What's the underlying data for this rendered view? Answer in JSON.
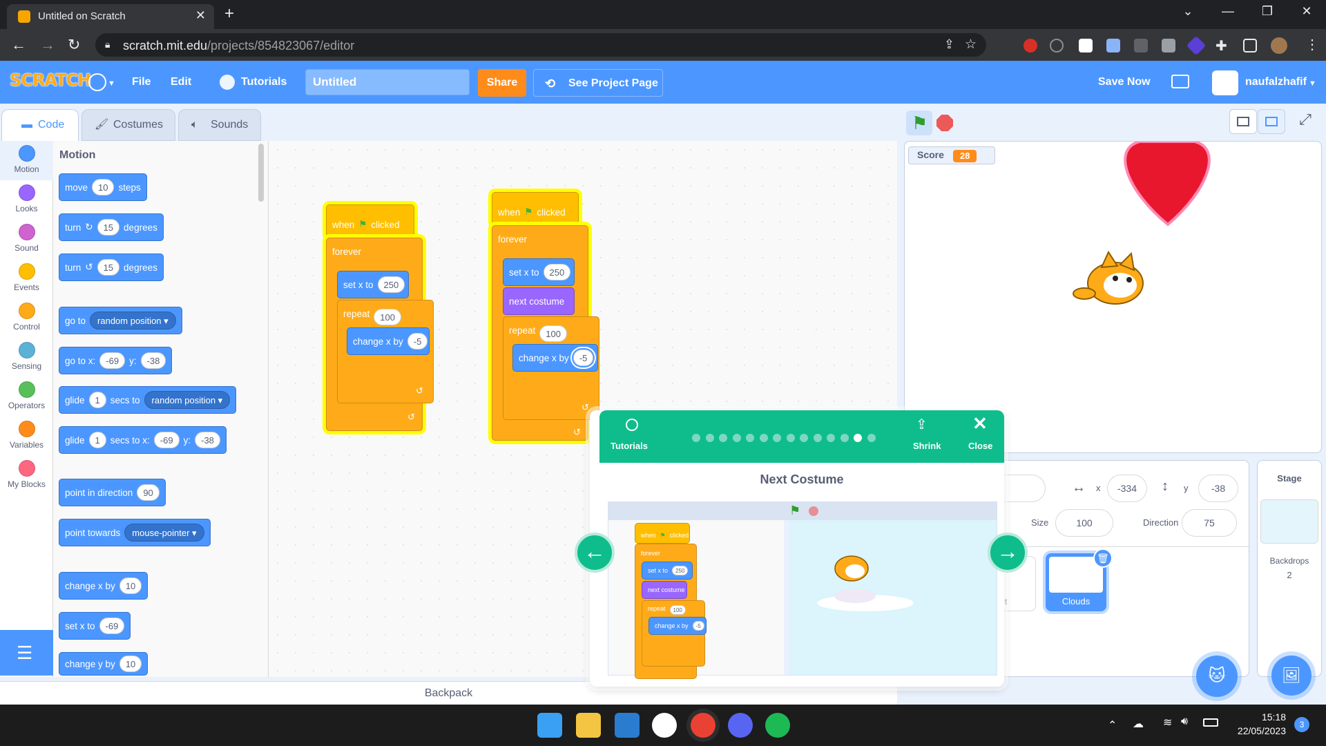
{
  "browser": {
    "tab_title": "Untitled on Scratch",
    "tab_close": "✕",
    "new_tab": "+",
    "url_host": "scratch.mit.edu",
    "url_path": "/projects/854823067/editor",
    "window_controls": [
      "⌄",
      "—",
      "❐",
      "✕"
    ]
  },
  "menubar": {
    "logo": "SCRATCH",
    "file": "File",
    "edit": "Edit",
    "tutorials": "Tutorials",
    "project_title": "Untitled",
    "share": "Share",
    "see_project": "See Project Page",
    "save_now": "Save Now",
    "username": "naufalzhafif",
    "colors": {
      "bar": "#4c97ff",
      "share": "#ff8c1a"
    }
  },
  "editor_tabs": [
    "Code",
    "Costumes",
    "Sounds"
  ],
  "categories": [
    {
      "label": "Motion",
      "color": "#4c97ff"
    },
    {
      "label": "Looks",
      "color": "#9966ff"
    },
    {
      "label": "Sound",
      "color": "#cf63cf"
    },
    {
      "label": "Events",
      "color": "#ffbf00"
    },
    {
      "label": "Control",
      "color": "#ffab19"
    },
    {
      "label": "Sensing",
      "color": "#5cb1d6"
    },
    {
      "label": "Operators",
      "color": "#59c059"
    },
    {
      "label": "Variables",
      "color": "#ff8c1a"
    },
    {
      "label": "My Blocks",
      "color": "#ff6680"
    }
  ],
  "palette": {
    "title": "Motion",
    "move": {
      "a": "move",
      "v": "10",
      "b": "steps"
    },
    "turn_cw": {
      "a": "turn",
      "v": "15",
      "b": "degrees"
    },
    "turn_ccw": {
      "a": "turn",
      "v": "15",
      "b": "degrees"
    },
    "goto": {
      "a": "go to",
      "dd": "random position"
    },
    "gotoxy": {
      "a": "go to x:",
      "x": "-69",
      "b": "y:",
      "y": "-38"
    },
    "glide": {
      "a": "glide",
      "v": "1",
      "b": "secs to",
      "dd": "random position"
    },
    "glidexy": {
      "a": "glide",
      "v": "1",
      "b": "secs to x:",
      "x": "-69",
      "c": "y:",
      "y": "-38"
    },
    "point_dir": {
      "a": "point in direction",
      "v": "90"
    },
    "point_towards": {
      "a": "point towards",
      "dd": "mouse-pointer"
    },
    "change_x": {
      "a": "change x by",
      "v": "10"
    },
    "set_x": {
      "a": "set x to",
      "v": "-69"
    },
    "change_y": {
      "a": "change y by",
      "v": "10"
    }
  },
  "scripts": {
    "s1": {
      "when": "when",
      "clicked": "clicked",
      "forever": "forever",
      "setx": "set x to",
      "setx_v": "250",
      "repeat": "repeat",
      "repeat_v": "100",
      "changex": "change x by",
      "changex_v": "-5"
    },
    "s2": {
      "when": "when",
      "clicked": "clicked",
      "forever": "forever",
      "setx": "set x to",
      "setx_v": "250",
      "next": "next costume",
      "repeat": "repeat",
      "repeat_v": "100",
      "changex": "change x by",
      "changex_v": "-5"
    }
  },
  "backpack": "Backpack",
  "stage": {
    "score_label": "Score",
    "score_value": "28"
  },
  "sprite_info": {
    "x_label": "x",
    "x": "-334",
    "y_label": "y",
    "y": "-38",
    "size_label": "Size",
    "size": "100",
    "direction_label": "Direction",
    "direction": "75",
    "sprite_partial_label": "rt",
    "selected_sprite": "Clouds"
  },
  "stage_panel": {
    "title": "Stage",
    "backdrops_label": "Backdrops",
    "backdrops_count": "2"
  },
  "tutorial": {
    "tutorials_label": "Tutorials",
    "shrink": "Shrink",
    "close": "Close",
    "title": "Next Costume",
    "dots_total": 14,
    "dots_active_index": 12,
    "mini": {
      "when": "when",
      "clicked": "clicked",
      "forever": "forever",
      "setx": "set x to",
      "setx_v": "250",
      "next": "next costume",
      "repeat": "repeat",
      "repeat_v": "100",
      "changex": "change x by",
      "changex_v": "-5"
    }
  },
  "taskbar": {
    "time": "15:18",
    "date": "22/05/2023",
    "notif": "3"
  }
}
